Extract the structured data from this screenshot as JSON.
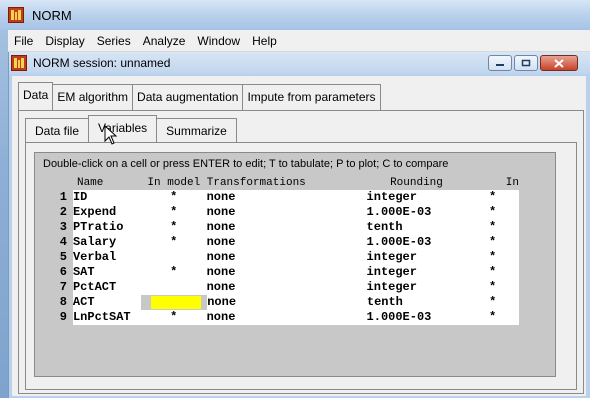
{
  "app": {
    "title": "NORM"
  },
  "menu": [
    "File",
    "Display",
    "Series",
    "Analyze",
    "Window",
    "Help"
  ],
  "session": {
    "title": "NORM session: unnamed"
  },
  "top_tabs": [
    {
      "label": "Data",
      "active": true
    },
    {
      "label": "EM algorithm",
      "active": false
    },
    {
      "label": "Data augmentation",
      "active": false
    },
    {
      "label": "Impute from parameters",
      "active": false
    }
  ],
  "sub_tabs": [
    {
      "label": "Data file",
      "active": false
    },
    {
      "label": "Variables",
      "active": true
    },
    {
      "label": "Summarize",
      "active": false
    }
  ],
  "instructions": "Double-click on a cell or press ENTER to edit; T to tabulate; P to plot; C to compare",
  "grid": {
    "headers": {
      "name": "Name",
      "in_model": "In model",
      "transformations": "Transformations",
      "rounding": "Rounding",
      "in_imp": "In *.imp"
    },
    "rows": [
      {
        "num": "1",
        "name": "ID",
        "in_model": "*",
        "transformation": "none",
        "rounding": "integer",
        "in_imp": "*"
      },
      {
        "num": "2",
        "name": "Expend",
        "in_model": "*",
        "transformation": "none",
        "rounding": "1.000E-03",
        "in_imp": "*"
      },
      {
        "num": "3",
        "name": "PTratio",
        "in_model": "*",
        "transformation": "none",
        "rounding": "tenth",
        "in_imp": "*"
      },
      {
        "num": "4",
        "name": "Salary",
        "in_model": "*",
        "transformation": "none",
        "rounding": "1.000E-03",
        "in_imp": "*"
      },
      {
        "num": "5",
        "name": "Verbal",
        "in_model": "",
        "transformation": "none",
        "rounding": "integer",
        "in_imp": "*"
      },
      {
        "num": "6",
        "name": "SAT",
        "in_model": "*",
        "transformation": "none",
        "rounding": "integer",
        "in_imp": "*"
      },
      {
        "num": "7",
        "name": "PctACT",
        "in_model": "",
        "transformation": "none",
        "rounding": "integer",
        "in_imp": "*"
      },
      {
        "num": "8",
        "name": "ACT",
        "in_model": "",
        "transformation": "none",
        "rounding": "tenth",
        "in_imp": "*",
        "highlight": true
      },
      {
        "num": "9",
        "name": "LnPctSAT",
        "in_model": "*",
        "transformation": "none",
        "rounding": "1.000E-03",
        "in_imp": "*"
      }
    ]
  },
  "colors": {
    "highlight": "#ffff00",
    "close_button": "#c6432a",
    "app_icon": "#c23b1c"
  },
  "icons": [
    "app-icon",
    "minimize-icon",
    "restore-icon",
    "close-icon",
    "mouse-cursor-icon"
  ]
}
